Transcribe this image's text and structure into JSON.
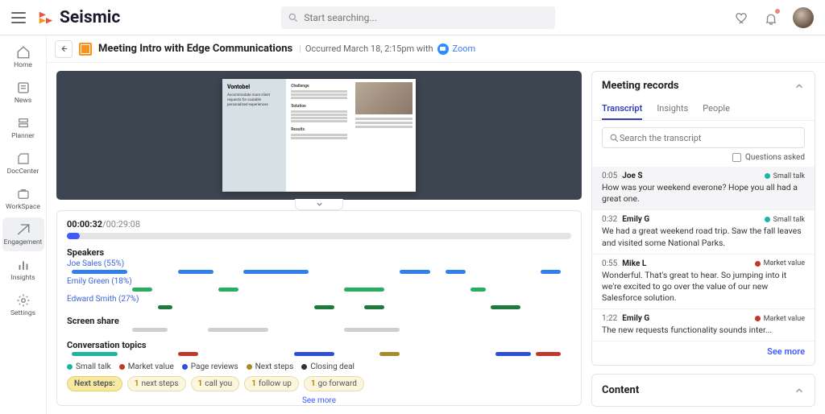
{
  "brand": "Seismic",
  "search_placeholder": "Start searching...",
  "nav": [
    {
      "label": "Home",
      "id": "home"
    },
    {
      "label": "News",
      "id": "news"
    },
    {
      "label": "Planner",
      "id": "planner"
    },
    {
      "label": "DocCenter",
      "id": "doccenter"
    },
    {
      "label": "WorkSpace",
      "id": "workspace"
    },
    {
      "label": "Engagement",
      "id": "engagement"
    },
    {
      "label": "Insights",
      "id": "insights"
    },
    {
      "label": "Settings",
      "id": "settings"
    }
  ],
  "active_nav": "engagement",
  "page": {
    "title": "Meeting Intro with Edge Communications",
    "occurred_pre": "Occurred March 18, 2:15pm with",
    "platform": "Zoom"
  },
  "doc_preview": {
    "brand": "Vontobel",
    "tagline": "Accommodate more client requests for scalable personalized experiences",
    "h1": "Challenge",
    "h2": "Solution",
    "h3": "Results"
  },
  "timeline": {
    "current": "00:00:32",
    "total": "/00:29:08",
    "progress_pct": 2.5,
    "speakers_label": "Speakers",
    "screen_label": "Screen share",
    "topics_label": "Conversation topics",
    "speakers": [
      {
        "name": "Joe Sales (55%)",
        "cls": "joe",
        "segs": [
          [
            1,
            12
          ],
          [
            22,
            29
          ],
          [
            35,
            48
          ],
          [
            66,
            72
          ],
          [
            75,
            79
          ],
          [
            94,
            98
          ]
        ]
      },
      {
        "name": "Emily Green (18%)",
        "cls": "emily",
        "segs": [
          [
            13,
            17
          ],
          [
            30,
            34
          ],
          [
            55,
            63
          ],
          [
            80,
            83
          ]
        ]
      },
      {
        "name": "Edward Smith (27%)",
        "cls": "edward",
        "segs": [
          [
            18,
            21
          ],
          [
            49,
            53
          ],
          [
            59,
            63
          ],
          [
            84,
            90
          ]
        ]
      }
    ],
    "share_segs": [
      [
        13,
        20
      ],
      [
        28,
        40
      ],
      [
        55,
        66
      ]
    ],
    "topics": [
      {
        "cls": "t-teal",
        "segs": [
          [
            1,
            10
          ]
        ]
      },
      {
        "cls": "t-red",
        "segs": [
          [
            22,
            26
          ],
          [
            93,
            98
          ]
        ]
      },
      {
        "cls": "t-blue",
        "segs": [
          [
            45,
            53
          ],
          [
            85,
            92
          ]
        ]
      },
      {
        "cls": "t-olive",
        "segs": [
          [
            62,
            66
          ]
        ]
      }
    ],
    "legend": [
      {
        "color": "#1cb5a3",
        "label": "Small talk"
      },
      {
        "color": "#c0392b",
        "label": "Market value"
      },
      {
        "color": "#2f4ed8",
        "label": "Page reviews"
      },
      {
        "color": "#aa8b2a",
        "label": "Next steps"
      },
      {
        "color": "#333",
        "label": "Closing deal"
      }
    ],
    "chips_header": "Next steps:",
    "chips": [
      {
        "n": "1",
        "t": "next steps"
      },
      {
        "n": "1",
        "t": "call you"
      },
      {
        "n": "1",
        "t": "follow up"
      },
      {
        "n": "1",
        "t": "go forward"
      }
    ],
    "seemore": "See more"
  },
  "records": {
    "title": "Meeting records",
    "tabs": [
      "Transcript",
      "Insights",
      "People"
    ],
    "active_tab": "Transcript",
    "search_placeholder": "Search the transcript",
    "questions_label": "Questions asked",
    "entries": [
      {
        "time": "0:05",
        "name": "Joe S",
        "tag": "Small talk",
        "tag_color": "#1cb5a3",
        "text": "How was your weekend everone? Hope you all had a great one.",
        "hl": true
      },
      {
        "time": "0:32",
        "name": "Emily G",
        "tag": "Small talk",
        "tag_color": "#1cb5a3",
        "text": "We had a great weekend road trip. Saw the fall leaves and visited some National Parks."
      },
      {
        "time": "0:55",
        "name": "Mike L",
        "tag": "Market value",
        "tag_color": "#c0392b",
        "text": "Wonderful. That's great to hear. So jumping into it we're excited to go over the value of our new Salesforce solution."
      },
      {
        "time": "1:22",
        "name": "Emily G",
        "tag": "Market value",
        "tag_color": "#c0392b",
        "text": "The new requests functionality sounds inter..."
      }
    ],
    "seemore": "See more"
  },
  "content_card": "Content"
}
